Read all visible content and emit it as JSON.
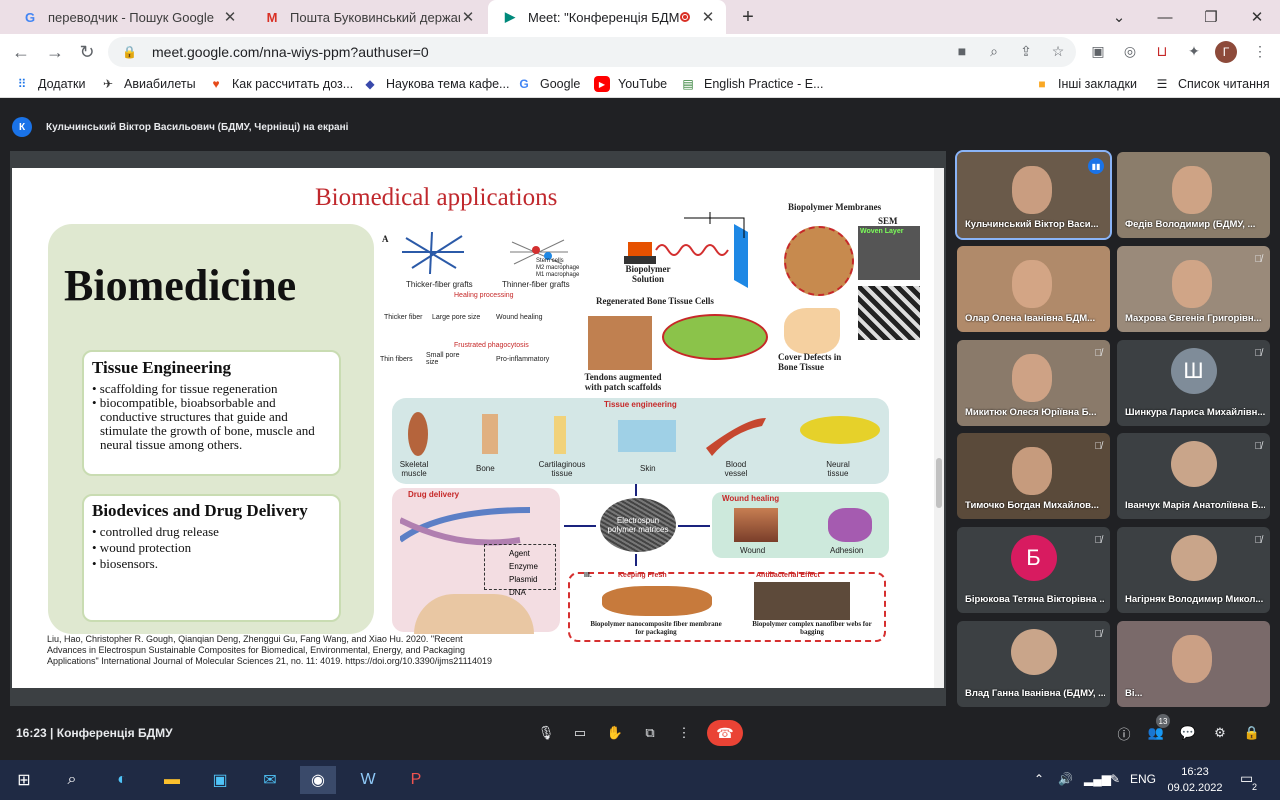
{
  "browser": {
    "tabs": [
      {
        "title": "переводчик - Пошук Google",
        "icon": "google-g-icon"
      },
      {
        "title": "Пошта Буковинський державн",
        "icon": "gmail-icon"
      },
      {
        "title": "Meet: \"Конференція БДМУ\"",
        "icon": "meet-icon",
        "active": true
      }
    ],
    "url": "meet.google.com/nna-wiys-ppm?authuser=0",
    "profile_initial": "Г",
    "bookmarks": [
      {
        "label": "Додатки",
        "icon": "apps-grid-icon"
      },
      {
        "label": "Авиабилеты",
        "icon": "plane-icon"
      },
      {
        "label": "Как рассчитать доз...",
        "icon": "heart-icon"
      },
      {
        "label": "Наукова тема кафе...",
        "icon": "diamond-icon"
      },
      {
        "label": "Google",
        "icon": "google-g-icon"
      },
      {
        "label": "YouTube",
        "icon": "youtube-icon"
      },
      {
        "label": "English Practice - E...",
        "icon": "book-icon"
      }
    ],
    "other_bookmarks": "Інші закладки",
    "reading_list": "Список читання"
  },
  "meet": {
    "presenter_initial": "К",
    "presenting_label": "Кульчинський Віктор Васильович (БДМУ, Чернівці) на екрані",
    "time": "16:23",
    "meeting_name": "Конференція БДМУ",
    "participants_count": "13",
    "participants": [
      {
        "name": "Кульчинський Віктор Васи...",
        "type": "video",
        "speaking": true
      },
      {
        "name": "Федів Володимир (БДМУ, ...",
        "type": "video"
      },
      {
        "name": "Олар Олена Іванівна БДМ...",
        "type": "video"
      },
      {
        "name": "Махрова Євгенія Григорівн...",
        "type": "video",
        "muted": true
      },
      {
        "name": "Микитюк Олеся Юріївна Б...",
        "type": "video",
        "muted": true
      },
      {
        "name": "Шинкура Лариса Михайлівн...",
        "type": "avatar",
        "initial": "Ш",
        "color": "#7f8c99",
        "muted": true
      },
      {
        "name": "Тимочко Богдан Михайлов...",
        "type": "video",
        "muted": true
      },
      {
        "name": "Іванчук Марія Анатоліївна Б...",
        "type": "photo",
        "muted": true
      },
      {
        "name": "Бірюкова Тетяна Вікторівна ...",
        "type": "avatar",
        "initial": "Б",
        "color": "#d81b60",
        "muted": true
      },
      {
        "name": "Нагірняк Володимир Микол...",
        "type": "photo",
        "muted": true
      },
      {
        "name": "Влад Ганна Іванівна (БДМУ, ...",
        "type": "photo",
        "muted": true
      },
      {
        "name": "Ві...",
        "type": "video"
      }
    ]
  },
  "slide": {
    "title": "Biomedical applications",
    "heading": "Biomedicine",
    "cards": [
      {
        "title": "Tissue Engineering",
        "items": [
          "• scaffolding for tissue regeneration",
          "• biocompatible, bioabsorbable and conductive structures that guide and stimulate the growth of bone, muscle and neural tissue among others."
        ]
      },
      {
        "title": "Biodevices and Drug Delivery",
        "items": [
          "• controlled drug release",
          "• wound protection",
          "•  biosensors."
        ]
      }
    ],
    "citation": "Liu, Hao, Christopher R. Gough, Qianqian Deng, Zhenggui Gu, Fang Wang, and Xiao Hu. 2020. \"Recent Advances in Electrospun Sustainable Composites for Biomedical, Environmental, Energy, and Packaging Applications\" International Journal of Molecular Sciences 21, no. 11: 4019. https://doi.org/10.3390/ijms21114019",
    "figure": {
      "panel_a": "A",
      "thicker_grafts": "Thicker-fiber grafts",
      "thinner_grafts": "Thinner-fiber grafts",
      "stem_cells": "Stem cells",
      "m2": "M2 macrophage",
      "m1": "M1 macrophage",
      "healing": "Healing processing",
      "thicker_fiber": "Thicker fiber",
      "large_pore": "Large pore size",
      "wound_healing_small": "Wound healing",
      "frustrated": "Frustrated phagocytosis",
      "thin_fibers": "Thin fibers",
      "small_pore": "Small pore size",
      "pro_inflam": "Pro-inflammatory",
      "biopolymer_solution": "Biopolymer Solution",
      "biopolymer_membranes": "Biopolymer Membranes",
      "sem": "SEM",
      "woven_layer": "Woven Layer",
      "regen_bone": "Regenerated Bone Tissue Cells",
      "tendons": "Tendons augmented with patch scaffolds",
      "cover_defects": "Cover Defects in Bone Tissue",
      "tissue_eng": "Tissue engineering",
      "tissues": [
        "Skeletal muscle",
        "Bone",
        "Cartilaginous tissue",
        "Skin",
        "Blood vessel",
        "Neural tissue"
      ],
      "drug_delivery": "Drug delivery",
      "agent": "Agent",
      "enzyme": "Enzyme",
      "plasmid": "Plasmid DNA",
      "electrospun": "Electrospun polymer matrices",
      "wound_healing": "Wound healing",
      "wound": "Wound",
      "adhesion": "Adhesion",
      "keeping_fresh": "Keeping Fresh",
      "antibacterial": "Antibacterial Effect",
      "packaging": "Biopolymer nanocomposite fiber membrane for packaging",
      "bagging": "Biopolymer complex nanofiber webs for bagging"
    }
  },
  "taskbar": {
    "lang": "ENG",
    "time": "16:23",
    "date": "09.02.2022",
    "notifications": "2"
  },
  "colors": {
    "slide_title": "#c0282d",
    "end_call": "#ea4335",
    "meet_bg": "#202124"
  }
}
